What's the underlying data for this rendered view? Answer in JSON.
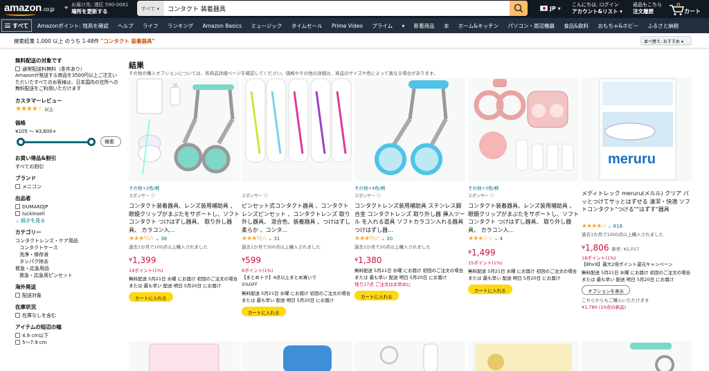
{
  "header": {
    "logo": "amazon",
    "logo_suffix": ".co.jp",
    "deliver_line1": "お届け先: 港区 590-0061",
    "deliver_line2": "場所を更新する",
    "search_category": "すべて",
    "search_value": "コンタクト 装着器具",
    "language": "JP",
    "account_line1": "こんにちは, ログイン",
    "account_line2": "アカウント&リスト",
    "orders_line1": "返品もこちら",
    "orders_line2": "注文履歴",
    "cart_count": "0",
    "cart_label": "カート"
  },
  "subnav": {
    "all_label": "すべて",
    "links": [
      "Amazonポイント: 残高を確認",
      "ヘルプ",
      "ライフ",
      "ランキング",
      "Amazon Basics",
      "ミュージック",
      "タイムセール",
      "Prime Video",
      "プライム",
      "新着商品",
      "本",
      "ホーム&キッチン",
      "パソコン・周辺機器",
      "食品&飲料",
      "おもちゃ&ホビー",
      "ふるさと納税"
    ]
  },
  "results": {
    "prefix": "検索結果 1,000 以上 のうち 1-48件 ",
    "query": "\"コンタクト 装着器具\"",
    "sort_label": "並べ替え: おすすめ"
  },
  "sidebar": {
    "free_ship_h": "無料配送の対象です",
    "free_ship_opt": "通常配送料無料（条件あり）",
    "free_ship_desc": "Amazonが発送する商品を3500円以上ご注文いただいたすべてのお客様は、日本国内の住所への無料配送をご利用いただけます",
    "review_h": "カスタマーレビュー",
    "review_up": "以上",
    "price_h": "価格",
    "price_range": "¥105 〜 ¥3,600+",
    "go_label": "検索",
    "deals_h": "お買い得品&割引",
    "deals_opt": "すべての割引",
    "brand_h": "ブランド",
    "brand_opt": "メニコン",
    "seller_h": "出品者",
    "sellers": [
      "DUMAKOJP",
      "luckinsell"
    ],
    "see_more": "続きを見る",
    "category_h": "カテゴリー",
    "categories": [
      "コンタクトレンズ・ケア用品",
      "コンタクトケース",
      "洗浄・保存液",
      "タンパク除去",
      "救急・応急用品",
      "救急・応急用ピンセット"
    ],
    "overseas_h": "海外発送",
    "overseas_opt": "配送対象",
    "stock_h": "在庫状況",
    "stock_opt": "在庫なしを含む",
    "width_h": "アイテムの短辺の幅",
    "widths": [
      "4.9 cm以下",
      "5〜7.9 cm"
    ]
  },
  "main": {
    "heading": "結果",
    "subheading": "その他の購入オプションについては、各商品詳細ページを確認してください。価格やその他の詳細は、商品のサイズや色によって異なる場合があります。"
  },
  "products": [
    {
      "options": "その他+2色/柄",
      "sponsor": "スポンサー",
      "title": "コンタクト装着器具、レンズ装用補助具 、眼鏡クリップがまぶたをサポートし、ソフトコンタクト つけはずし器具、 取り外し器具、 カラコン入...",
      "rating": 3.5,
      "reviews": "38",
      "bought": "過去1か月で100点以上購入されました",
      "price": "1,399",
      "ref": "",
      "points": "14ポイント(1%)",
      "promo": "",
      "ship1": "無料配送 5月21日 水曜 にお届け 初回のご注文の場合",
      "ship2": "または 最も早い 配送 明日 5月20日 にお届け",
      "stock": "",
      "button": "カートに入れる",
      "image": "clip-teal"
    },
    {
      "options": "",
      "sponsor": "スポンサー",
      "title": "ピンセット式コンタクト器具 、コンタクトレンズピンセット 、コンタクトレンズ 取り外し器具、 混合色、装着器具 、つけはずし柔らか 、コンタ...",
      "rating": 3.5,
      "reviews": "31",
      "bought": "過去1か月で300点以上購入されました",
      "price": "599",
      "ref": "",
      "points": "6ポイント(1%)",
      "promo": "【まとめトク】4点以上まとめ買いで 5%OFF",
      "ship1": "無料配送 5月21日 水曜 にお届け 初回のご注文の場合",
      "ship2": "または 最も早い 配送 明日 5月20日 にお届け",
      "stock": "",
      "button": "カートに入れる",
      "image": "tweezers"
    },
    {
      "options": "その他+4色/柄",
      "sponsor": "スポンサー",
      "title": "コンタクトレンズ装用補助具 ステンレス鋼合金 コンタクトレンズ 取り外し器 挿入ツール を入れる道具 ソフトカラコン入れる器具 つけはずし器...",
      "rating": 3.5,
      "reviews": "20",
      "bought": "過去1か月で20点以上購入されました",
      "price": "1,380",
      "ref": "",
      "points": "",
      "promo": "",
      "ship1": "無料配送 5月21日 水曜 にお届け 初回のご注文の場合",
      "ship2": "または 最も早い 配送 明日 5月20日 にお届け",
      "stock": "残り17点 ご注文はお早めに",
      "button": "カートに入れる",
      "image": "clip-blue"
    },
    {
      "options": "その他+3色/柄",
      "sponsor": "スポンサー",
      "title": "コンタクト装着器具、レンズ装用補助具 、眼鏡クリップがまぶたをサポートし、ソフトコンタクト つけはずし器具、 取り外し器具、 カラコン入...",
      "rating": 3.0,
      "reviews": "4",
      "bought": "",
      "price": "1,499",
      "ref": "",
      "points": "15ポイント(1%)",
      "promo": "",
      "ship1": "無料配送 5月21日 水曜 にお届け 初回のご注文の場合",
      "ship2": "または 最も早い 配送 明日 5月20日 にお届け",
      "stock": "",
      "button": "カートに入れる",
      "image": "clip-pink"
    },
    {
      "options": "",
      "sponsor": "",
      "title": "メディトレック meruru(メルル) クリア パッとつけてサッとはずせる 清潔・快適 ソフトコンタクト\"つける\"\"はずす\"器具",
      "rating": 4.0,
      "reviews": "816",
      "bought": "過去1か月で1000点以上購入されました",
      "price": "1,806",
      "ref": "参考: ¥2,017",
      "points": "18ポイント(1%)",
      "promo": "【8for8】最大2倍ポイント還元キャンペーン",
      "ship1": "無料配送 5月21日 水曜 にお届け 初回のご注文の場合",
      "ship2": "または 最も早い 配送 明日 5月20日 にお届け",
      "stock": "",
      "button": "オプションを表示",
      "other1": "こちらからもご購入いただけます",
      "other2": "¥1,780 (10点の新品)",
      "image": "meruru"
    }
  ],
  "colors": {
    "nav_dark": "#131921",
    "nav_sub": "#232f3e",
    "accent_orange": "#ff9900",
    "search_button": "#febd69",
    "price_red": "#cc0c39",
    "link_teal": "#007185",
    "cart_yellow": "#ffd814",
    "star": "#ffa41c"
  }
}
